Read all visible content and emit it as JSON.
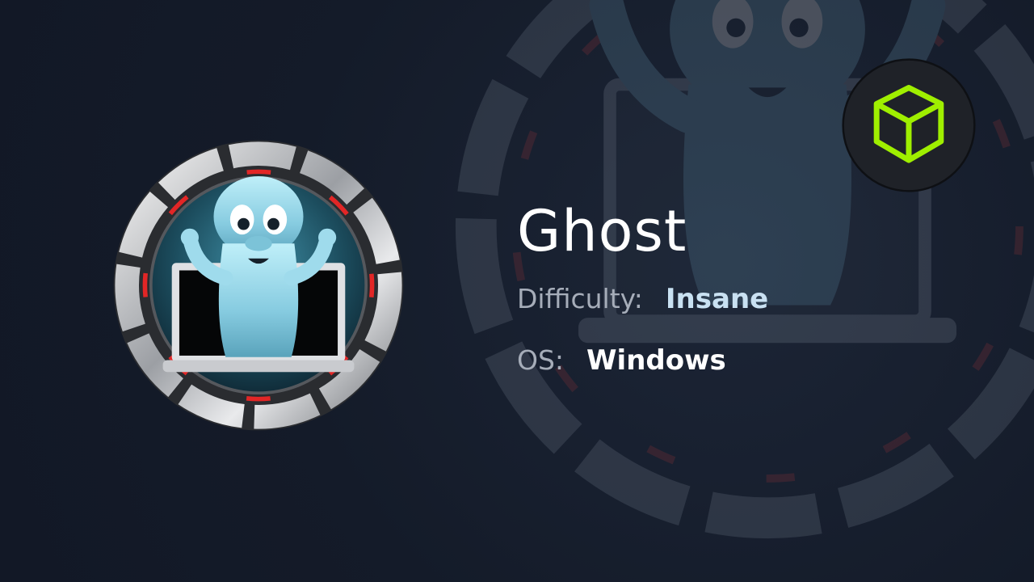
{
  "machine": {
    "name": "Ghost",
    "difficulty_label": "Difficulty:",
    "difficulty": "Insane",
    "os_label": "OS:",
    "os": "Windows"
  },
  "icons": {
    "badge": "ghost-laptop-badge-icon",
    "logo": "hack-the-box-cube-icon"
  },
  "colors": {
    "background": "#141b29",
    "difficulty_value": "#c9e1f2",
    "os_value": "#ffffff",
    "label": "#a6adb9",
    "cube_green": "#9fef00",
    "ring_red": "#e22626"
  }
}
